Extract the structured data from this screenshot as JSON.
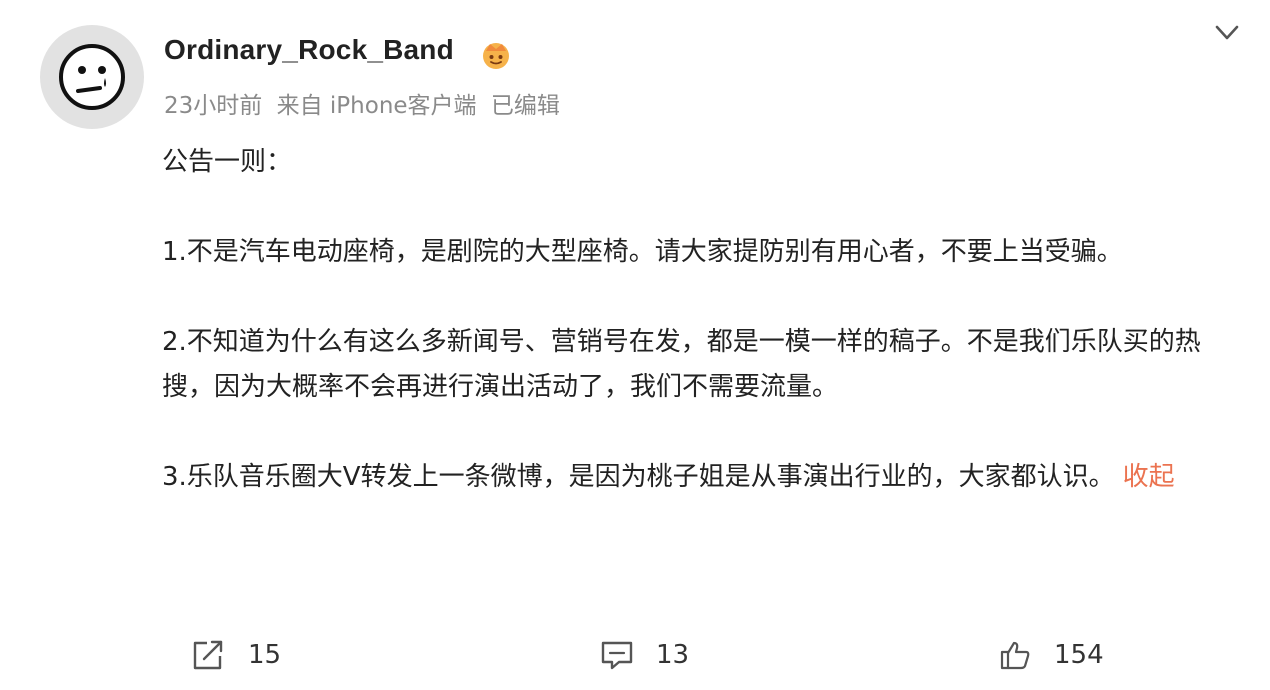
{
  "post": {
    "username": "Ordinary_Rock_Band",
    "time": "23小时前",
    "source": "来自 iPhone客户端",
    "edited": "已编辑",
    "paragraphs": [
      "公告一则：",
      "1.不是汽车电动座椅，是剧院的大型座椅。请大家提防别有用心者，不要上当受骗。",
      "2.不知道为什么有这么多新闻号、营销号在发，都是一模一样的稿子。不是我们乐队买的热搜，因为大概率不会再进行演出活动了，我们不需要流量。",
      "3.乐队音乐圈大V转发上一条微博，是因为桃子姐是从事演出行业的，大家都认识。"
    ],
    "collapse_label": "收起"
  },
  "actions": {
    "repost_count": "15",
    "comment_count": "13",
    "like_count": "154"
  },
  "colors": {
    "link": "#eb7350",
    "meta": "#8a8a8a",
    "text": "#222222"
  },
  "icons": {
    "badge": "crown-badge-icon",
    "expand": "chevron-down-icon",
    "repost": "repost-icon",
    "comment": "comment-icon",
    "like": "thumbs-up-icon"
  }
}
